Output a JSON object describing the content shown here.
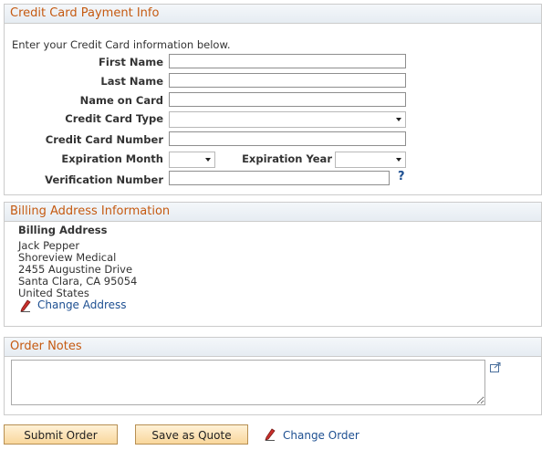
{
  "payment": {
    "header": "Credit Card Payment Info",
    "intro": "Enter your Credit Card information below.",
    "first_name_label": "First Name",
    "last_name_label": "Last Name",
    "name_on_card_label": "Name on Card",
    "card_type_label": "Credit Card Type",
    "card_number_label": "Credit Card Number",
    "exp_month_label": "Expiration Month",
    "exp_year_label": "Expiration Year",
    "verification_label": "Verification Number",
    "first_name_value": "",
    "last_name_value": "",
    "name_on_card_value": "",
    "card_number_value": "",
    "verification_value": "",
    "help_glyph": "?"
  },
  "billing": {
    "header": "Billing Address Information",
    "title": "Billing Address",
    "lines": [
      "Jack Pepper",
      "Shoreview Medical",
      "2455 Augustine Drive",
      "Santa Clara, CA 95054",
      "United States"
    ],
    "change_address_label": "Change Address"
  },
  "notes": {
    "header": "Order Notes"
  },
  "footer": {
    "submit_label": "Submit Order",
    "save_quote_label": "Save as Quote",
    "change_order_label": "Change Order"
  },
  "colors": {
    "header_text": "#c55a11",
    "link": "#1d4f91",
    "button_border": "#b78f52"
  },
  "icons": {
    "edit": "pencil-icon",
    "expand": "expand-icon",
    "help": "help-icon",
    "dropdown": "chevron-down-icon"
  }
}
